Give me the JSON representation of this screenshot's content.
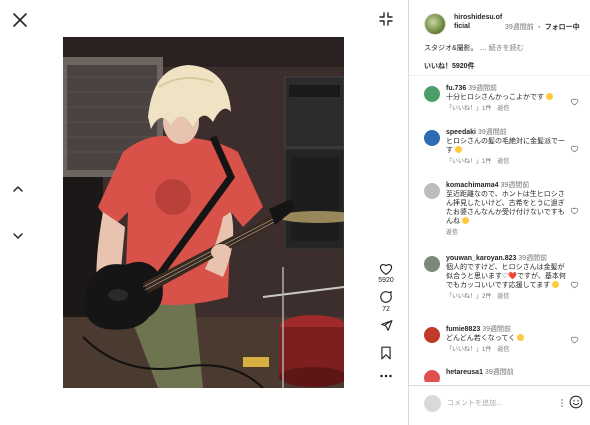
{
  "viewer": {
    "photo_alt": "",
    "actions": {
      "like_count": "5920",
      "comment_count": "72"
    }
  },
  "post": {
    "username": "hiroshidesu.official",
    "time": "39週間前",
    "follow_label": "フォロー中",
    "caption": "スタジオ&撮影。",
    "more_label": "続きを読む",
    "likes": "いいね！5920件"
  },
  "comments": [
    {
      "user": "fu.736",
      "time": "39週間前",
      "text": "十分ヒロシさんかっこよかです",
      "likes_label": "「いいね！」1件",
      "reply_label": "返信",
      "avatar_color": "#4a9e6a"
    },
    {
      "user": "speedaki",
      "time": "39週間前",
      "text": "ヒロシさんの髪の毛絶対に金髪派でーす",
      "likes_label": "「いいね！」1件",
      "reply_label": "返信",
      "avatar_color": "#2b6cb0"
    },
    {
      "user": "komachimama4",
      "time": "39週間前",
      "text": "至近距離なので、ホントは生ヒロシさん拝見したいけど、古希をとうに過ぎたお婆さんなんか受け付けないですもんね",
      "likes_label": "",
      "reply_label": "返信",
      "avatar_color": "#bdbdbd"
    },
    {
      "user": "youwan_karoyan.823",
      "time": "39週間前",
      "text": "個人的ですけど、ヒロシさんは金髪が似合うと思います♡❤️ですが、基本何でもカッコいいです応援してます",
      "likes_label": "「いいね！」2件",
      "reply_label": "返信",
      "avatar_color": "#7a8a7a"
    },
    {
      "user": "fumie8823",
      "time": "39週間前",
      "text": "どんどん若くなってく",
      "likes_label": "「いいね！」1件",
      "reply_label": "返信",
      "avatar_color": "#c0392b"
    },
    {
      "user": "hetareusa1",
      "time": "39週間前",
      "text": "",
      "likes_label": "",
      "reply_label": "",
      "avatar_color": "#e05050"
    }
  ],
  "composer": {
    "placeholder": "コメントを追加..."
  },
  "colors": {
    "accent": "#0095f6",
    "text": "#262626",
    "muted": "#737373",
    "border": "#dbdbdb"
  },
  "icons": [
    "close-icon",
    "collapse-icon",
    "chevron-up-icon",
    "chevron-down-icon",
    "heart-icon",
    "comment-icon",
    "share-icon",
    "bookmark-icon",
    "more-icon",
    "emoji-icon"
  ]
}
